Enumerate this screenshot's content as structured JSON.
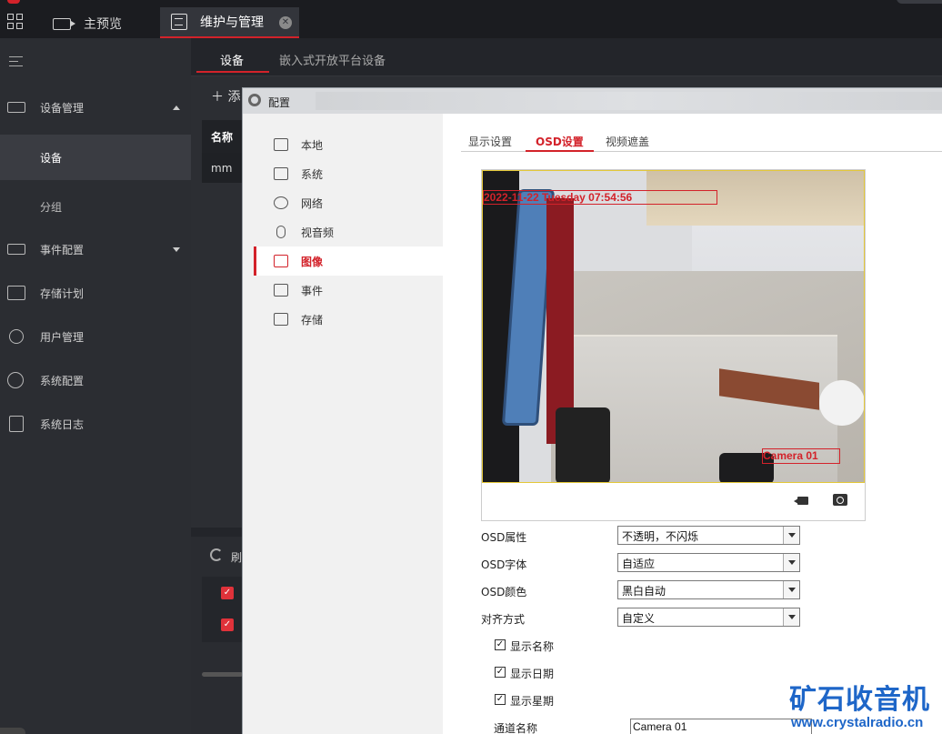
{
  "topbar": {
    "tabs": [
      {
        "label": "主预览"
      },
      {
        "label": "维护与管理"
      }
    ]
  },
  "sidebar": {
    "items": [
      {
        "label": "设备管理"
      },
      {
        "label": "设备"
      },
      {
        "label": "分组"
      },
      {
        "label": "事件配置"
      },
      {
        "label": "存储计划"
      },
      {
        "label": "用户管理"
      },
      {
        "label": "系统配置"
      },
      {
        "label": "系统日志"
      }
    ]
  },
  "main": {
    "subtabs": [
      {
        "label": "设备"
      },
      {
        "label": "嵌入式开放平台设备"
      }
    ],
    "add_label": "添",
    "table": {
      "header": "名称",
      "rows": [
        "mm"
      ]
    },
    "refresh_label": "刷"
  },
  "dialog": {
    "title": "配置",
    "menu": [
      {
        "label": "本地",
        "icon": "monitor-icon"
      },
      {
        "label": "系统",
        "icon": "window-icon"
      },
      {
        "label": "网络",
        "icon": "globe-icon"
      },
      {
        "label": "视音频",
        "icon": "microphone-icon"
      },
      {
        "label": "图像",
        "icon": "image-icon"
      },
      {
        "label": "事件",
        "icon": "calendar-icon"
      },
      {
        "label": "存储",
        "icon": "save-icon"
      }
    ],
    "tabs": [
      {
        "label": "显示设置"
      },
      {
        "label": "OSD设置"
      },
      {
        "label": "视频遮盖"
      }
    ],
    "osd_date_text": "2022-11-22 Tuesday 07:54:56",
    "osd_name_text": "Camera 01",
    "form": {
      "osd_attr": {
        "label": "OSD属性",
        "value": "不透明，不闪烁"
      },
      "osd_font": {
        "label": "OSD字体",
        "value": "自适应"
      },
      "osd_color": {
        "label": "OSD颜色",
        "value": "黑白自动"
      },
      "align": {
        "label": "对齐方式",
        "value": "自定义"
      },
      "show_name": {
        "label": "显示名称",
        "checked": true
      },
      "show_date": {
        "label": "显示日期",
        "checked": true
      },
      "show_week": {
        "label": "显示星期",
        "checked": true
      },
      "channel_name": {
        "label": "通道名称",
        "value": "Camera 01"
      }
    }
  },
  "watermark": {
    "title": "矿石收音机",
    "url": "www.crystalradio.cn"
  }
}
